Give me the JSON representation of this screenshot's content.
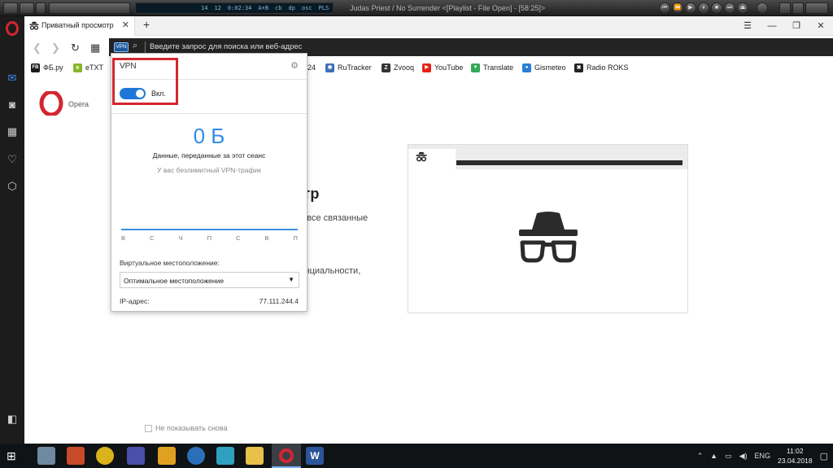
{
  "player": {
    "lcd_items": [
      "14",
      "12",
      "0:02:34",
      "A+B",
      "cb",
      "dp",
      "osc",
      "PLS"
    ],
    "track_title": "Judas Priest / No Surrender    <[Playlist - File Open] - [58:25]>"
  },
  "tab": {
    "title": "Приватный просмотр",
    "close": "✕",
    "new": "+"
  },
  "window_controls": {
    "minimize": "—",
    "maximize": "❐",
    "close": "✕",
    "menu": "☰"
  },
  "nav": {
    "back": "❮",
    "forward": "❯",
    "reload": "↻",
    "grid": "▦"
  },
  "address_bar": {
    "vpn_badge": "VPN",
    "placeholder": "Введите запрос для поиска или веб-адрес"
  },
  "bookmarks": [
    {
      "label": "ФБ.ру",
      "icon": "FB",
      "color": "#1b1b1b"
    },
    {
      "label": "eTXT",
      "icon": "e",
      "color": "#86b72a"
    },
    {
      "label": "24",
      "icon": "",
      "color": "#ffffff"
    },
    {
      "label": "RuTracker",
      "icon": "✱",
      "color": "#3b6fb6"
    },
    {
      "label": "Zvooq",
      "icon": "Z",
      "color": "#333333"
    },
    {
      "label": "YouTube",
      "icon": "▶",
      "color": "#e62117"
    },
    {
      "label": "Translate",
      "icon": "▼",
      "color": "#34a853"
    },
    {
      "label": "Gismeteo",
      "icon": "●",
      "color": "#2a7fd4"
    },
    {
      "label": "Radio ROKS",
      "icon": "✖",
      "color": "#222222"
    }
  ],
  "page": {
    "brand": "Opera",
    "heading_fragment": "отр",
    "paragraph1_fragment": "он все связанные",
    "paragraph2_fragment": "денциальности,",
    "dont_show": "Не показывать снова"
  },
  "vpn_popup": {
    "title": "VPN",
    "toggle_label": "Вкл.",
    "toggle_on": true,
    "data_amount": "0 Б",
    "data_caption": "Данные, переданные за этот сеанс",
    "unlimited": "У вас безлимитный VPN-трафик",
    "weekdays": [
      "В",
      "С",
      "Ч",
      "П",
      "С",
      "В",
      "П"
    ],
    "location_label": "Виртуальное местоположение:",
    "location_value": "Оптимальное местоположение",
    "ip_label": "IP-адрес:",
    "ip_value": "77.111.244.4"
  },
  "taskbar": {
    "language": "ENG",
    "time": "11:02",
    "date": "23.04.2018"
  },
  "colors": {
    "accent": "#2f8ce6",
    "opera_red": "#d32630",
    "highlight_box": "#d32630"
  }
}
